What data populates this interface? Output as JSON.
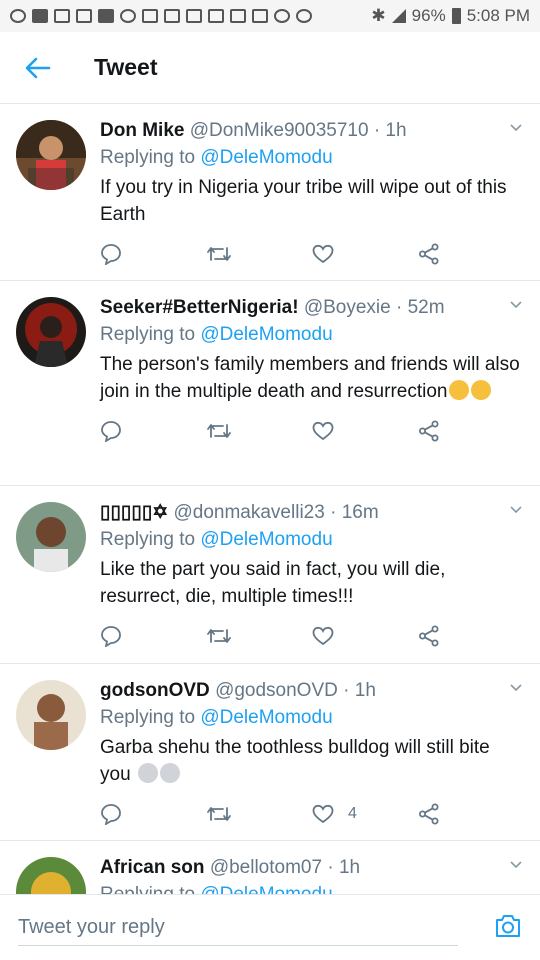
{
  "status_bar": {
    "battery": "96%",
    "time": "5:08 PM"
  },
  "header": {
    "title": "Tweet"
  },
  "tweets": [
    {
      "name": "Don Mike",
      "handle": "@DonMike90035710",
      "time": "· 1h",
      "replying_prefix": "Replying to ",
      "replying_to": "@DeleMomodu",
      "text": "If you try in Nigeria your tribe will wipe out of this Earth",
      "like_count": ""
    },
    {
      "name": "Seeker#BetterNigeria!",
      "handle": "@Boyexie",
      "time": "· 52m",
      "replying_prefix": "Replying to ",
      "replying_to": "@DeleMomodu",
      "text": "The person's family members and friends will also join in the multiple death and resurrection",
      "like_count": ""
    },
    {
      "name": "▯▯▯▯▯✡",
      "handle": "@donmakavelli23",
      "time": "· 16m",
      "replying_prefix": "Replying to ",
      "replying_to": "@DeleMomodu",
      "text": "Like the part  you said in fact, you will die, resurrect, die, multiple times!!!",
      "like_count": ""
    },
    {
      "name": "godsonOVD",
      "handle": "@godsonOVD",
      "time": "· 1h",
      "replying_prefix": "Replying to ",
      "replying_to": "@DeleMomodu",
      "text": "Garba shehu the toothless bulldog will still bite you",
      "like_count": "4"
    },
    {
      "name": "African son",
      "handle": "@bellotom07",
      "time": "· 1h",
      "replying_prefix": "Replying to ",
      "replying_to": "@DeleMomodu",
      "text": "",
      "like_count": ""
    }
  ],
  "reply_bar": {
    "placeholder": "Tweet your reply"
  },
  "colors": {
    "accent": "#1da1f2",
    "muted": "#657786",
    "divider": "#e1e8ed"
  }
}
